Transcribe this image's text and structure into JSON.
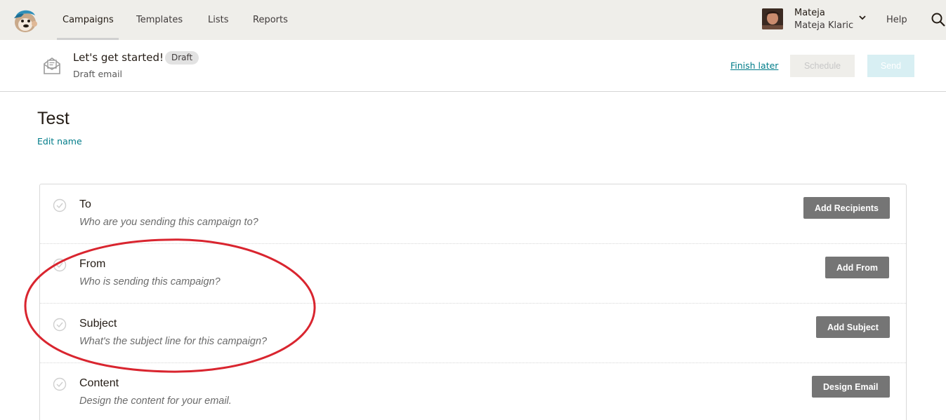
{
  "topnav": {
    "logo_name": "mailchimp-freddie-logo",
    "items": [
      {
        "label": "Campaigns",
        "active": true
      },
      {
        "label": "Templates",
        "active": false
      },
      {
        "label": "Lists",
        "active": false
      },
      {
        "label": "Reports",
        "active": false
      }
    ],
    "user": {
      "name": "Mateja",
      "full_name": "Mateja Klaric"
    },
    "help_label": "Help",
    "search_icon": "search-icon"
  },
  "campaign_bar": {
    "title": "Let's get started!",
    "badge": "Draft",
    "subtitle": "Draft email",
    "finish_later": "Finish later",
    "schedule_label": "Schedule",
    "send_label": "Send"
  },
  "campaign": {
    "name": "Test",
    "edit_name_label": "Edit name"
  },
  "checklist": [
    {
      "label": "To",
      "hint": "Who are you sending this campaign to?",
      "action": "Add Recipients"
    },
    {
      "label": "From",
      "hint": "Who is sending this campaign?",
      "action": "Add From"
    },
    {
      "label": "Subject",
      "hint": "What's the subject line for this campaign?",
      "action": "Add Subject"
    },
    {
      "label": "Content",
      "hint": "Design the content for your email.",
      "action": "Design Email"
    }
  ],
  "colors": {
    "nav_bg": "#efeeea",
    "link": "#007c89",
    "action_button": "#757575",
    "send_disabled": "#d8eff3",
    "annotation": "#d9252f"
  }
}
